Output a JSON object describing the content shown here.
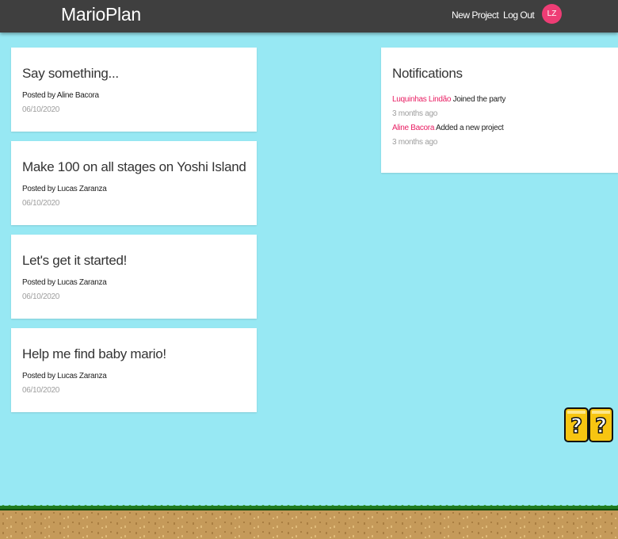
{
  "navbar": {
    "brand": "MarioPlan",
    "links": {
      "new_project": "New Project",
      "log_out": "Log Out"
    },
    "avatar_initials": "LZ",
    "avatar_color": "#ee3d75"
  },
  "projects": [
    {
      "title": "Say something...",
      "author": "Posted by Aline Bacora",
      "date": "06/10/2020"
    },
    {
      "title": "Make 100 on all stages on Yoshi Island",
      "author": "Posted by Lucas Zaranza",
      "date": "06/10/2020"
    },
    {
      "title": "Let's get it started!",
      "author": "Posted by Lucas Zaranza",
      "date": "06/10/2020"
    },
    {
      "title": "Help me find baby mario!",
      "author": "Posted by Lucas Zaranza",
      "date": "06/10/2020"
    }
  ],
  "notifications": {
    "title": "Notifications",
    "items": [
      {
        "user": "Luquinhas Lindão",
        "action": "Joined the party",
        "time": "3 months ago"
      },
      {
        "user": "Aline Bacora",
        "action": "Added a new project",
        "time": "3 months ago"
      }
    ]
  },
  "colors": {
    "background": "#97e8f3",
    "navbar": "#3f3f3f",
    "accent_pink": "#e91e63",
    "grass": "#2f9e2f",
    "dirt": "#c59a5a"
  },
  "decorations": {
    "question_blocks": "question-block-icon",
    "ground": "grass-ground"
  }
}
